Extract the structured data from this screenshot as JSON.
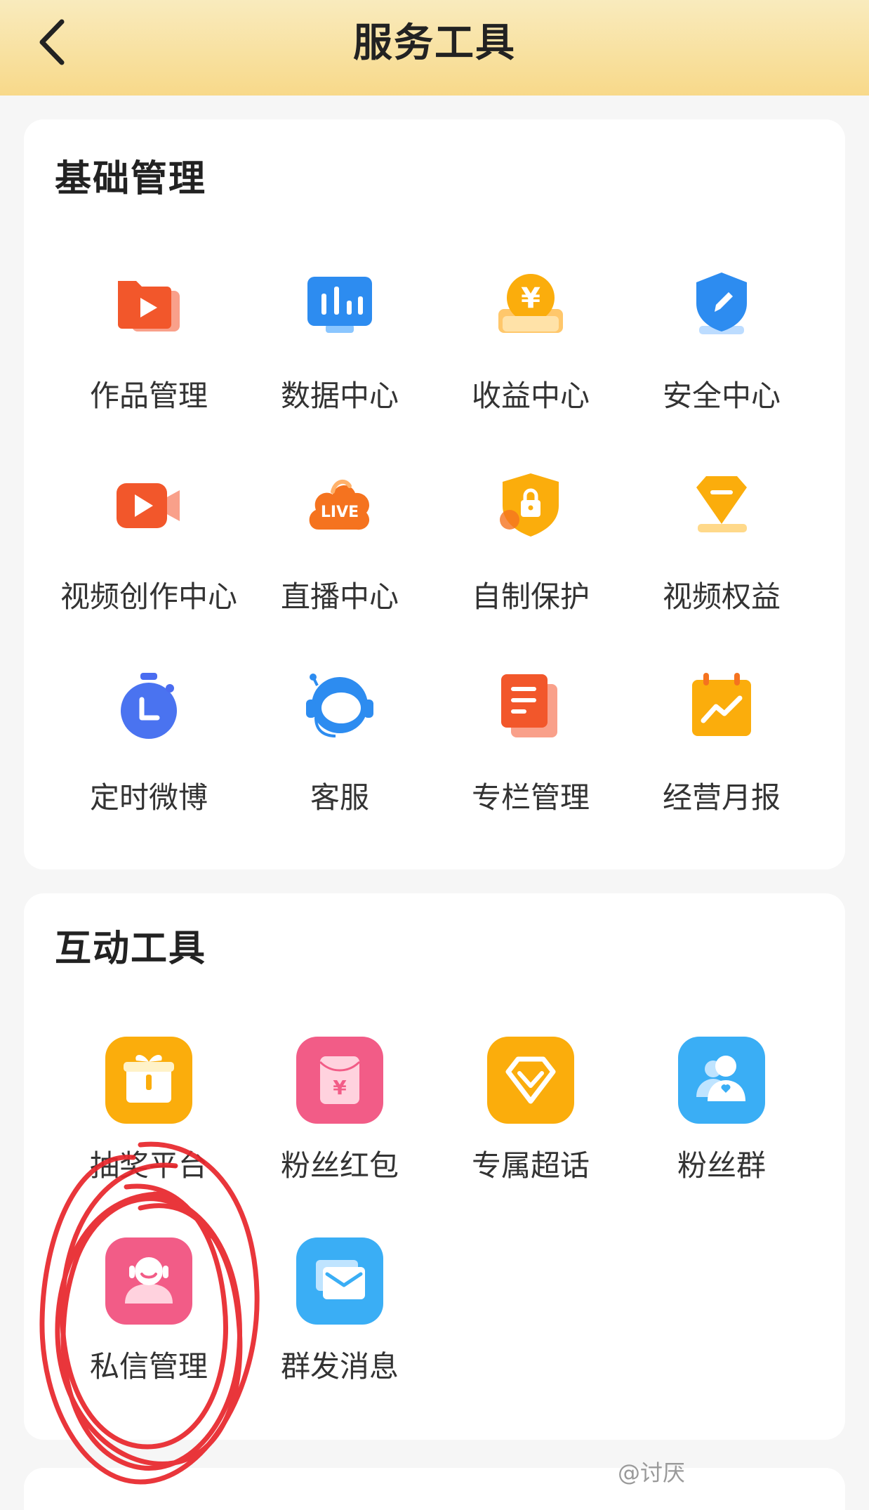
{
  "header": {
    "title": "服务工具",
    "back_icon": "chevron-left-icon"
  },
  "basic": {
    "title": "基础管理",
    "items": [
      {
        "label": "作品管理",
        "icon": "folder-play-icon"
      },
      {
        "label": "数据中心",
        "icon": "monitor-chart-icon"
      },
      {
        "label": "收益中心",
        "icon": "yen-coin-icon"
      },
      {
        "label": "安全中心",
        "icon": "shield-pen-icon"
      },
      {
        "label": "视频创作中心",
        "icon": "video-camera-icon"
      },
      {
        "label": "直播中心",
        "icon": "live-cloud-icon"
      },
      {
        "label": "自制保护",
        "icon": "shield-lock-icon"
      },
      {
        "label": "视频权益",
        "icon": "diamond-badge-icon"
      },
      {
        "label": "定时微博",
        "icon": "stopwatch-icon"
      },
      {
        "label": "客服",
        "icon": "headset-icon"
      },
      {
        "label": "专栏管理",
        "icon": "document-icon"
      },
      {
        "label": "经营月报",
        "icon": "calendar-chart-icon"
      }
    ]
  },
  "interactive": {
    "title": "互动工具",
    "items": [
      {
        "label": "抽奖平台",
        "icon": "gift-icon"
      },
      {
        "label": "粉丝红包",
        "icon": "red-envelope-icon"
      },
      {
        "label": "专属超话",
        "icon": "diamond-icon"
      },
      {
        "label": "粉丝群",
        "icon": "user-group-icon"
      },
      {
        "label": "私信管理",
        "icon": "person-message-icon"
      },
      {
        "label": "群发消息",
        "icon": "mail-icon"
      }
    ]
  },
  "colors": {
    "header_top": "#f9ebbd",
    "header_bottom": "#f8d98a",
    "annotation_red": "#e8252b"
  },
  "watermark": "@讨厌"
}
